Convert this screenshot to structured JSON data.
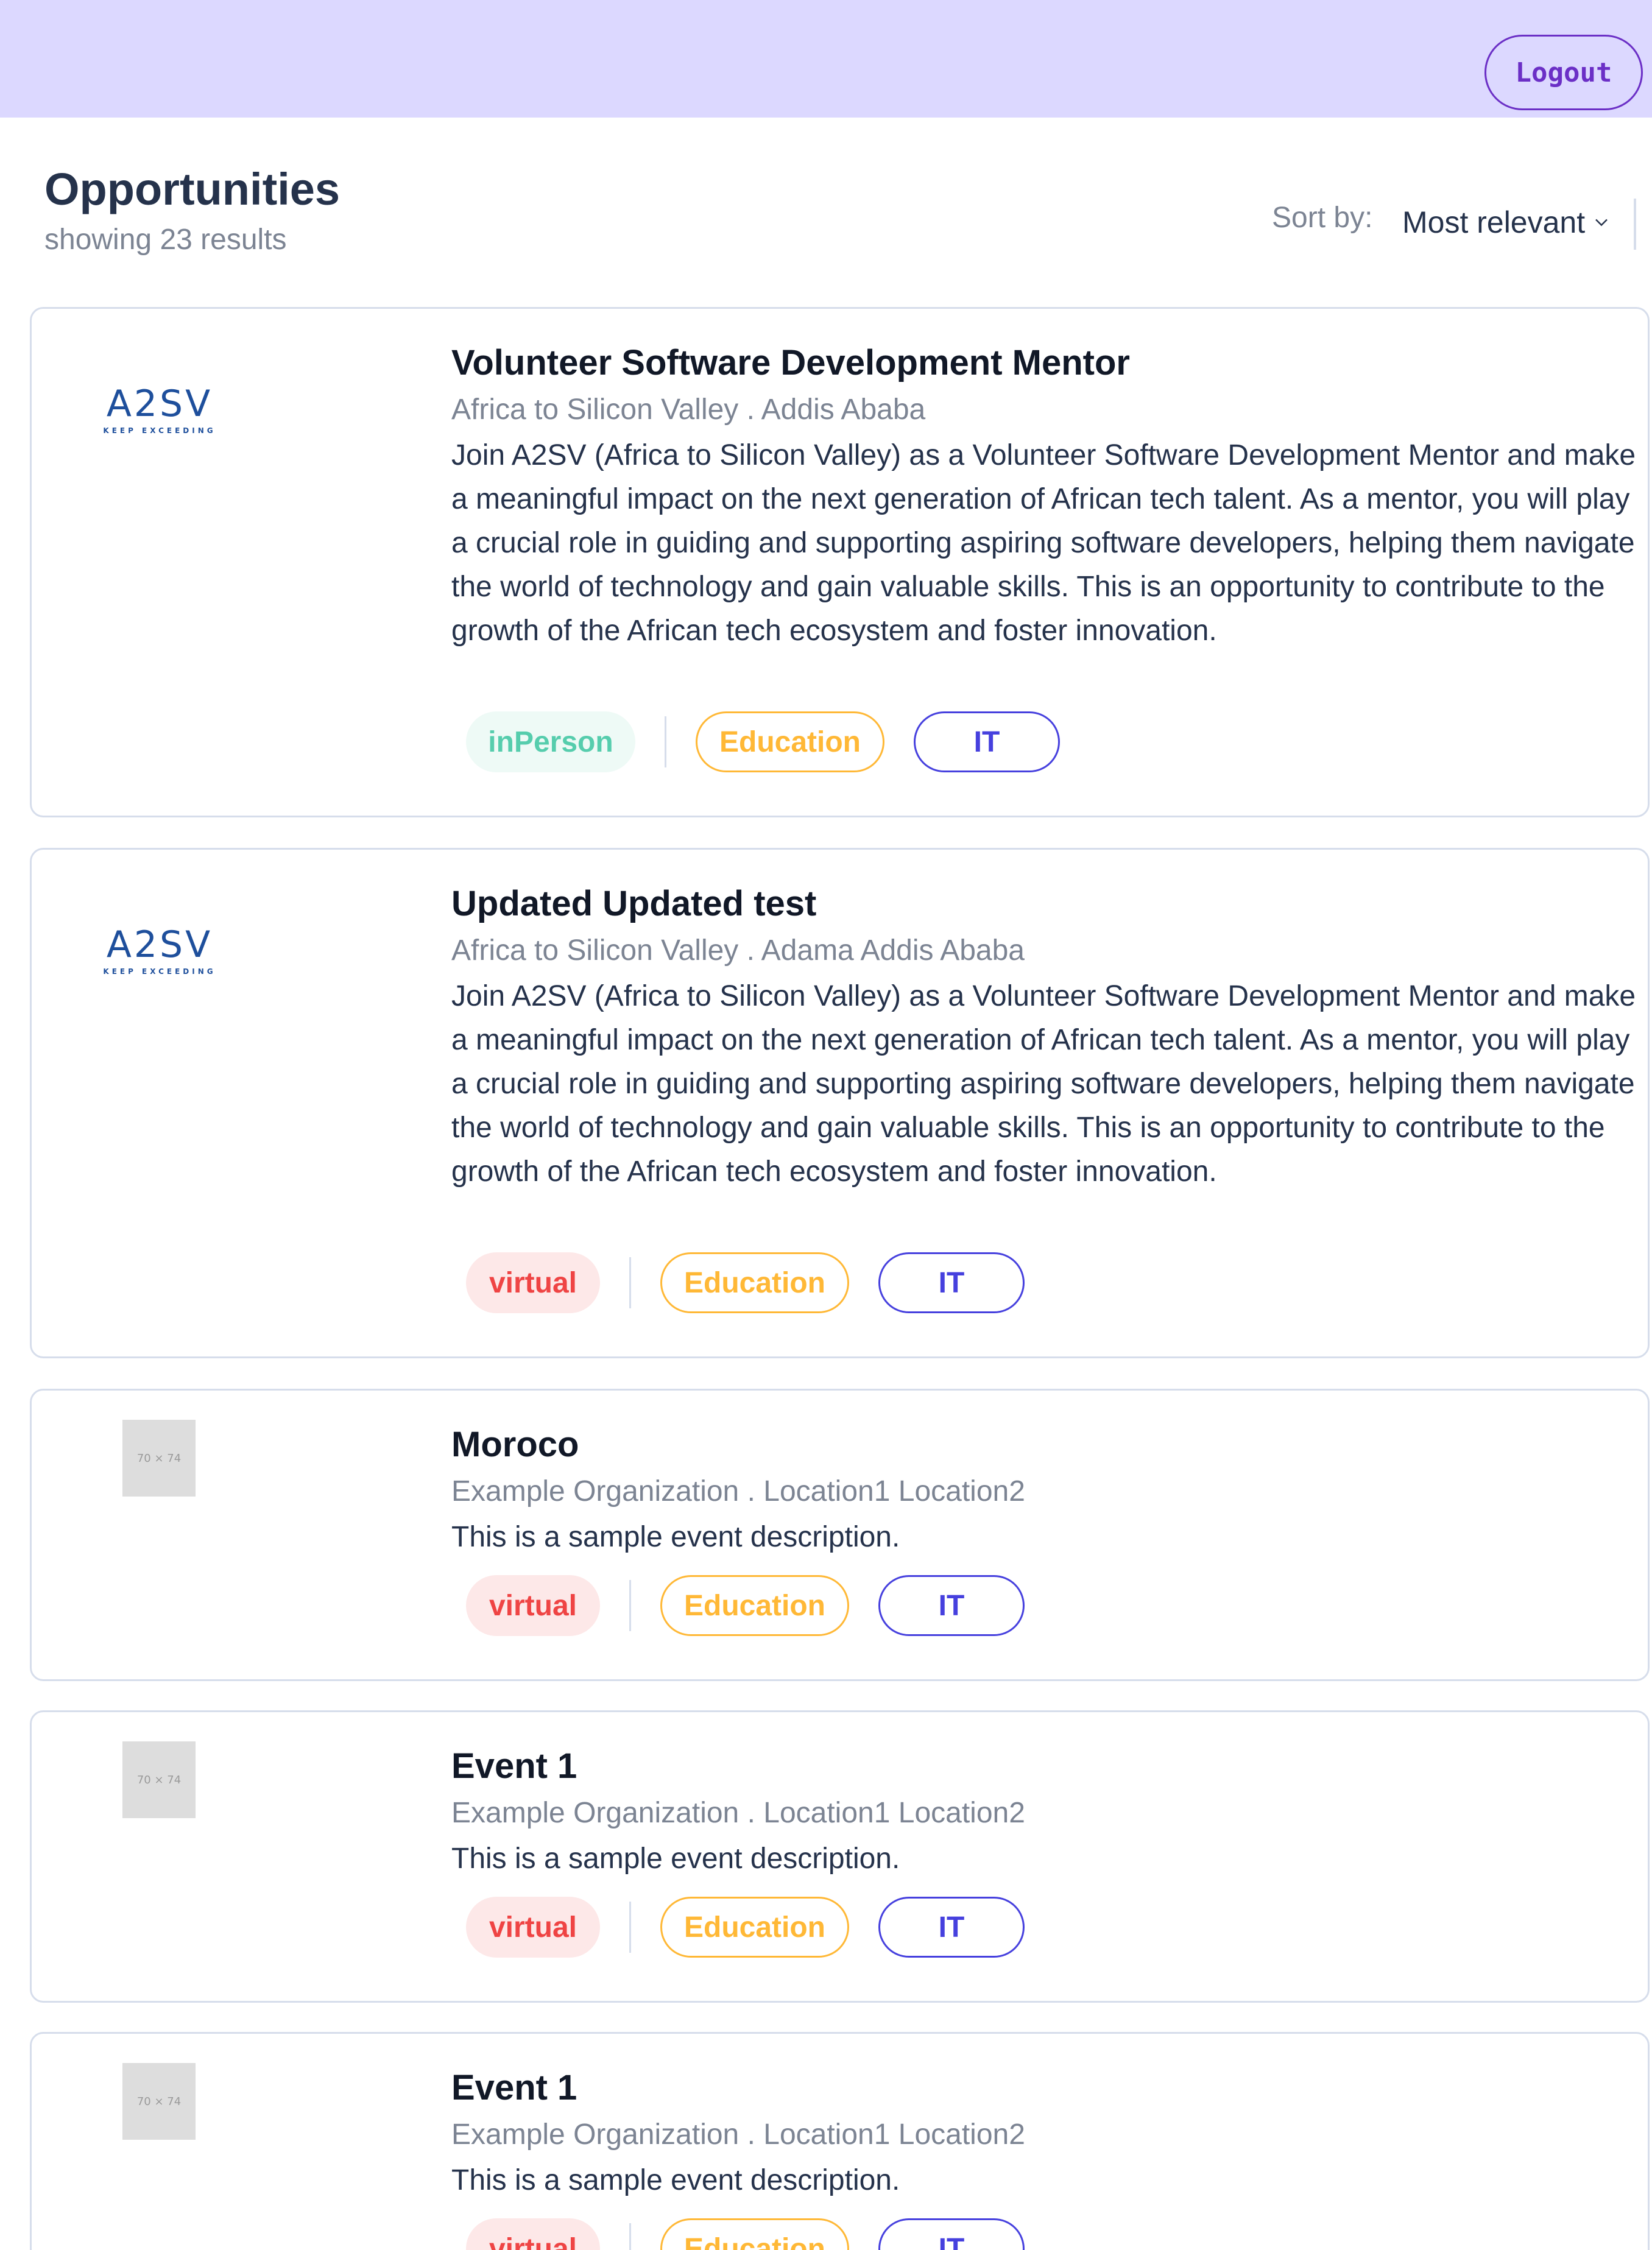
{
  "header": {
    "logout_label": "Logout"
  },
  "page": {
    "title": "Opportunities",
    "result_count": "showing 23 results",
    "sort_label": "Sort by:",
    "sort_value": "Most relevant"
  },
  "logo": {
    "brand": "A2SV",
    "tagline": "KEEP EXCEEDING",
    "placeholder": "70 × 74"
  },
  "cards": [
    {
      "title": "Volunteer Software Development Mentor",
      "meta": "Africa to Silicon Valley .   Addis Ababa",
      "description": "Join A2SV (Africa to Silicon Valley) as a Volunteer Software Development Mentor and make a meaningful impact on the next generation of African tech talent. As a mentor, you will play a crucial role in guiding and supporting aspiring software developers, helping them navigate the world of technology and gain valuable skills. This is an opportunity to contribute to the growth of the African tech ecosystem and foster innovation.",
      "mode": "inPerson",
      "categories": [
        "Education",
        "IT"
      ]
    },
    {
      "title": "Updated Updated test",
      "meta": "Africa to Silicon Valley .   Adama  Addis Ababa",
      "description": "Join A2SV (Africa to Silicon Valley) as a Volunteer Software Development Mentor and make a meaningful impact on the next generation of African tech talent. As a mentor, you will play a crucial role in guiding and supporting aspiring software developers, helping them navigate the world of technology and gain valuable skills. This is an opportunity to contribute to the growth of the African tech ecosystem and foster innovation.",
      "mode": "virtual",
      "categories": [
        "Education",
        "IT"
      ]
    },
    {
      "title": "Moroco",
      "meta": "Example Organization .   Location1  Location2",
      "description": "This is a sample event description.",
      "mode": "virtual",
      "categories": [
        "Education",
        "IT"
      ]
    },
    {
      "title": "Event 1",
      "meta": "Example Organization .   Location1  Location2",
      "description": "This is a sample event description.",
      "mode": "virtual",
      "categories": [
        "Education",
        "IT"
      ]
    },
    {
      "title": "Event 1",
      "meta": "Example Organization .   Location1  Location2",
      "description": "This is a sample event description.",
      "mode": "virtual",
      "categories": [
        "Education",
        "IT"
      ]
    }
  ]
}
